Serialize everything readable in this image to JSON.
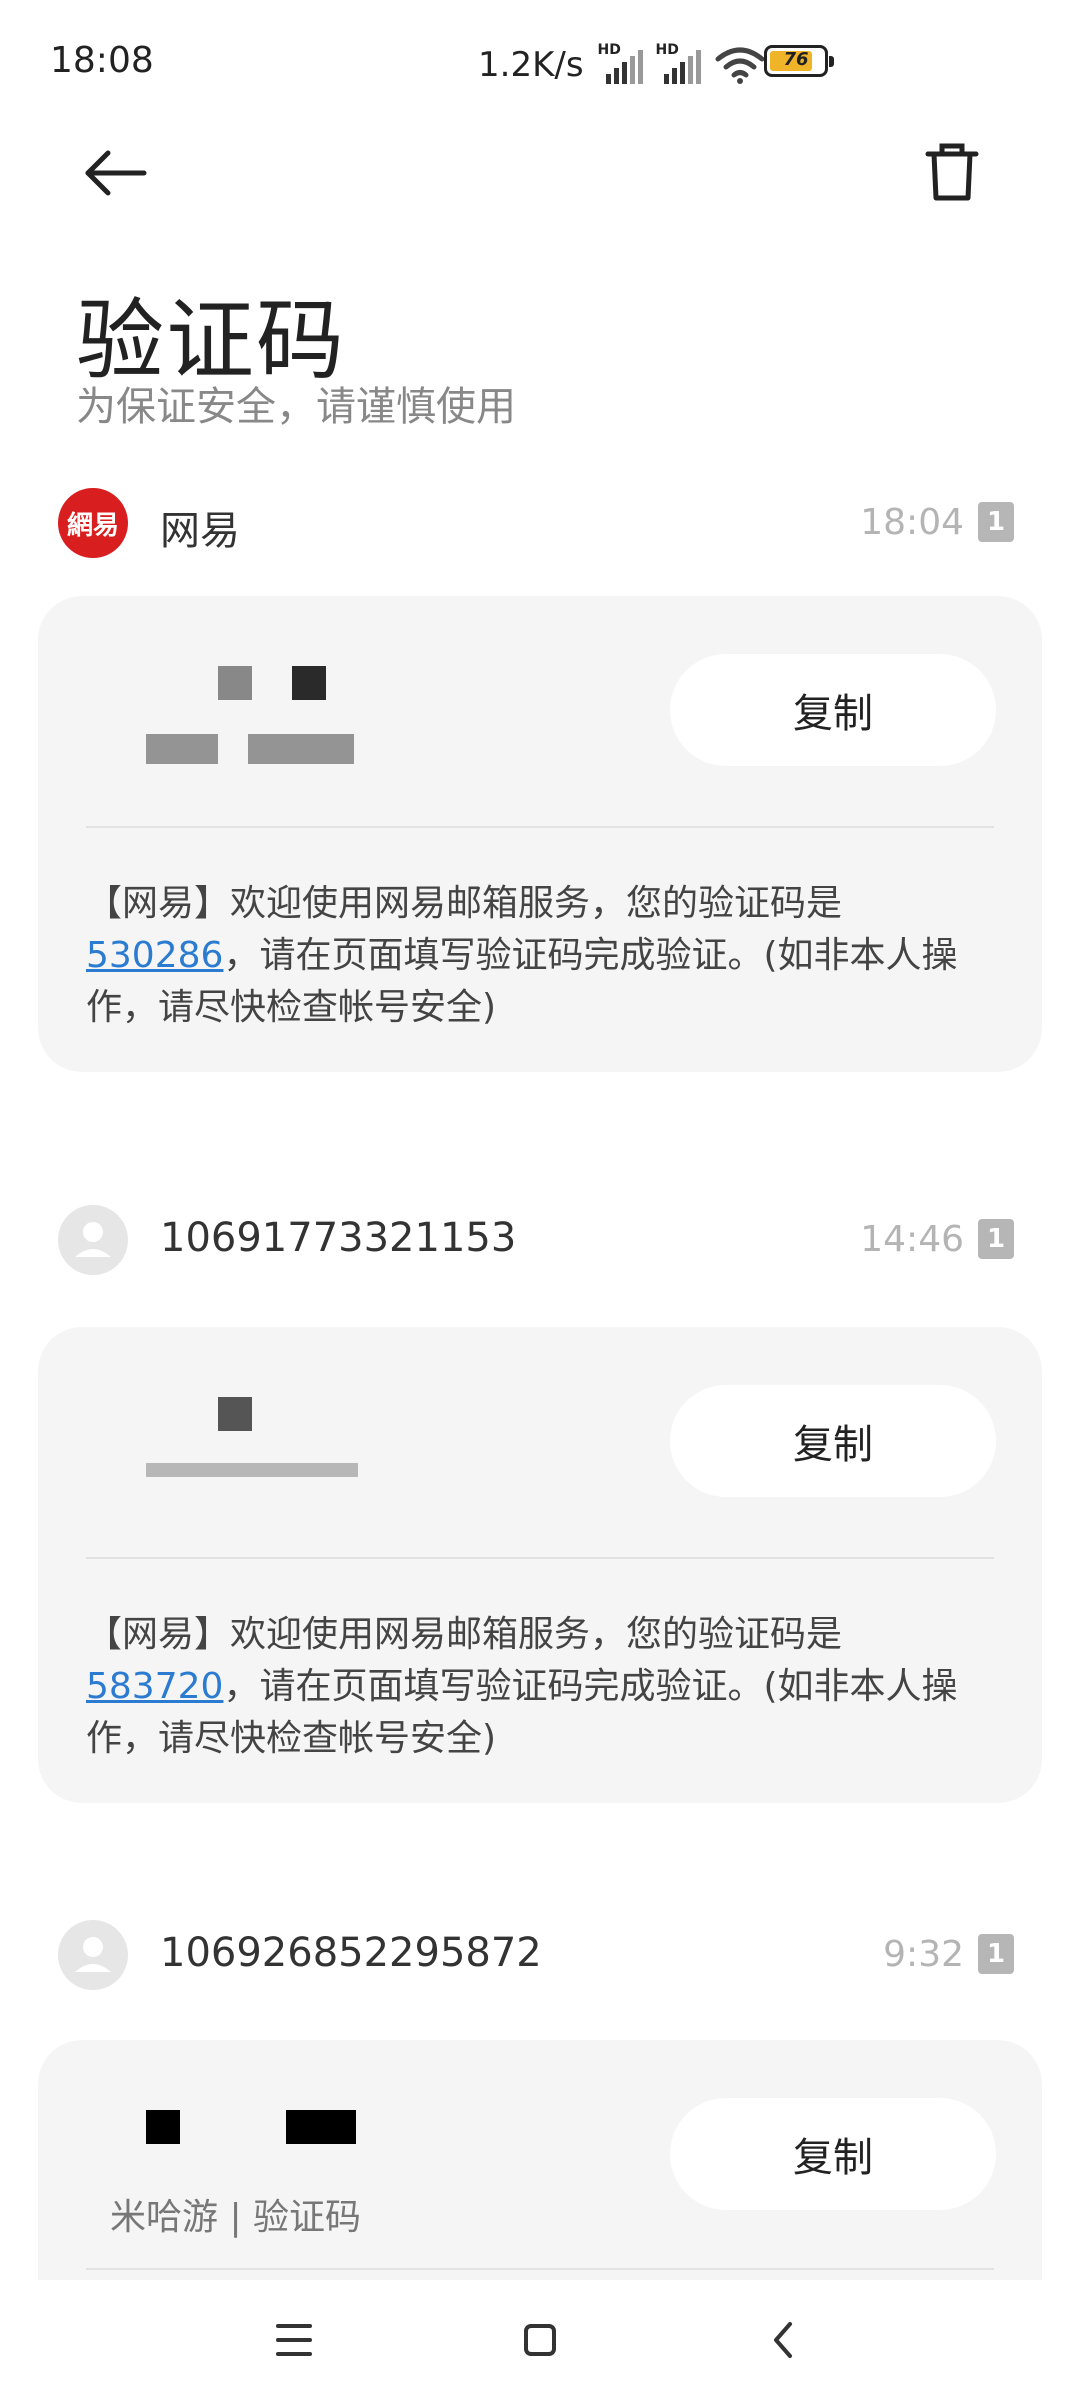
{
  "status_bar": {
    "time": "18:08",
    "net_speed": "1.2K/s",
    "battery": "76",
    "icons": [
      "hd-signal-icon",
      "hd-signal-icon",
      "wifi-icon",
      "battery-icon"
    ]
  },
  "header": {
    "title": "验证码",
    "subtitle": "为保证安全，请谨慎使用"
  },
  "messages": [
    {
      "sender": "网易",
      "avatar_text": "網易",
      "time": "18:04",
      "sim": "1",
      "copy_label": "复制",
      "text_before": "【网易】欢迎使用网易邮箱服务，您的验证码是",
      "code": "530286",
      "text_after": "，请在页面填写验证码完成验证。(如非本人操作，请尽快检查帐号安全)"
    },
    {
      "sender": "10691773321153",
      "time": "14:46",
      "sim": "1",
      "copy_label": "复制",
      "text_before": "【网易】欢迎使用网易邮箱服务，您的验证码是",
      "code": "583720",
      "text_after": "，请在页面填写验证码完成验证。(如非本人操作，请尽快检查帐号安全)"
    },
    {
      "sender": "106926852295872",
      "time": "9:32",
      "sim": "1",
      "copy_label": "复制",
      "source_line": "米哈游 | 验证码"
    }
  ],
  "colors": {
    "card_bg": "#f5f5f5",
    "link": "#2b7bd0",
    "netease_red": "#d81e1e",
    "battery_fill": "#f0b429"
  }
}
